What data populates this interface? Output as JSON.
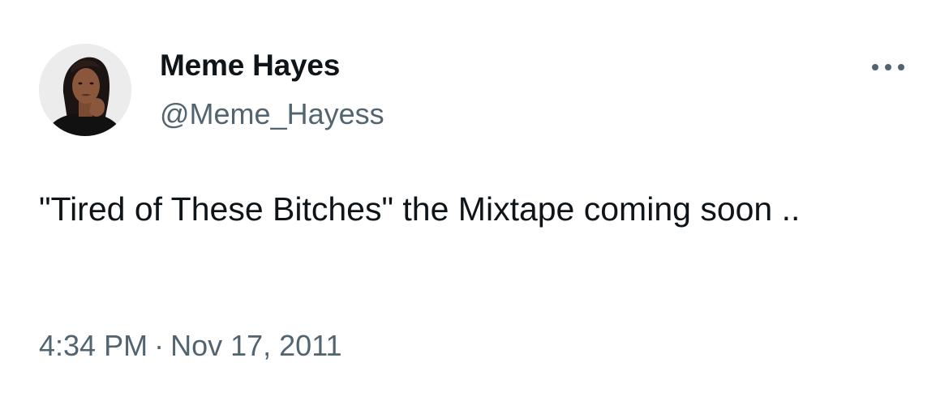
{
  "author": {
    "display_name": "Meme Hayes",
    "handle": "@Meme_Hayess",
    "avatar_icon": "profile-photo"
  },
  "tweet": {
    "text": "\"Tired of These Bitches\" the Mixtape coming soon ..",
    "time": "4:34 PM",
    "separator": "·",
    "date": "Nov 17, 2011"
  },
  "actions": {
    "more_icon": "more-horizontal-icon"
  },
  "colors": {
    "primary_text": "#0f1419",
    "secondary_text": "#536471",
    "background": "#ffffff"
  }
}
